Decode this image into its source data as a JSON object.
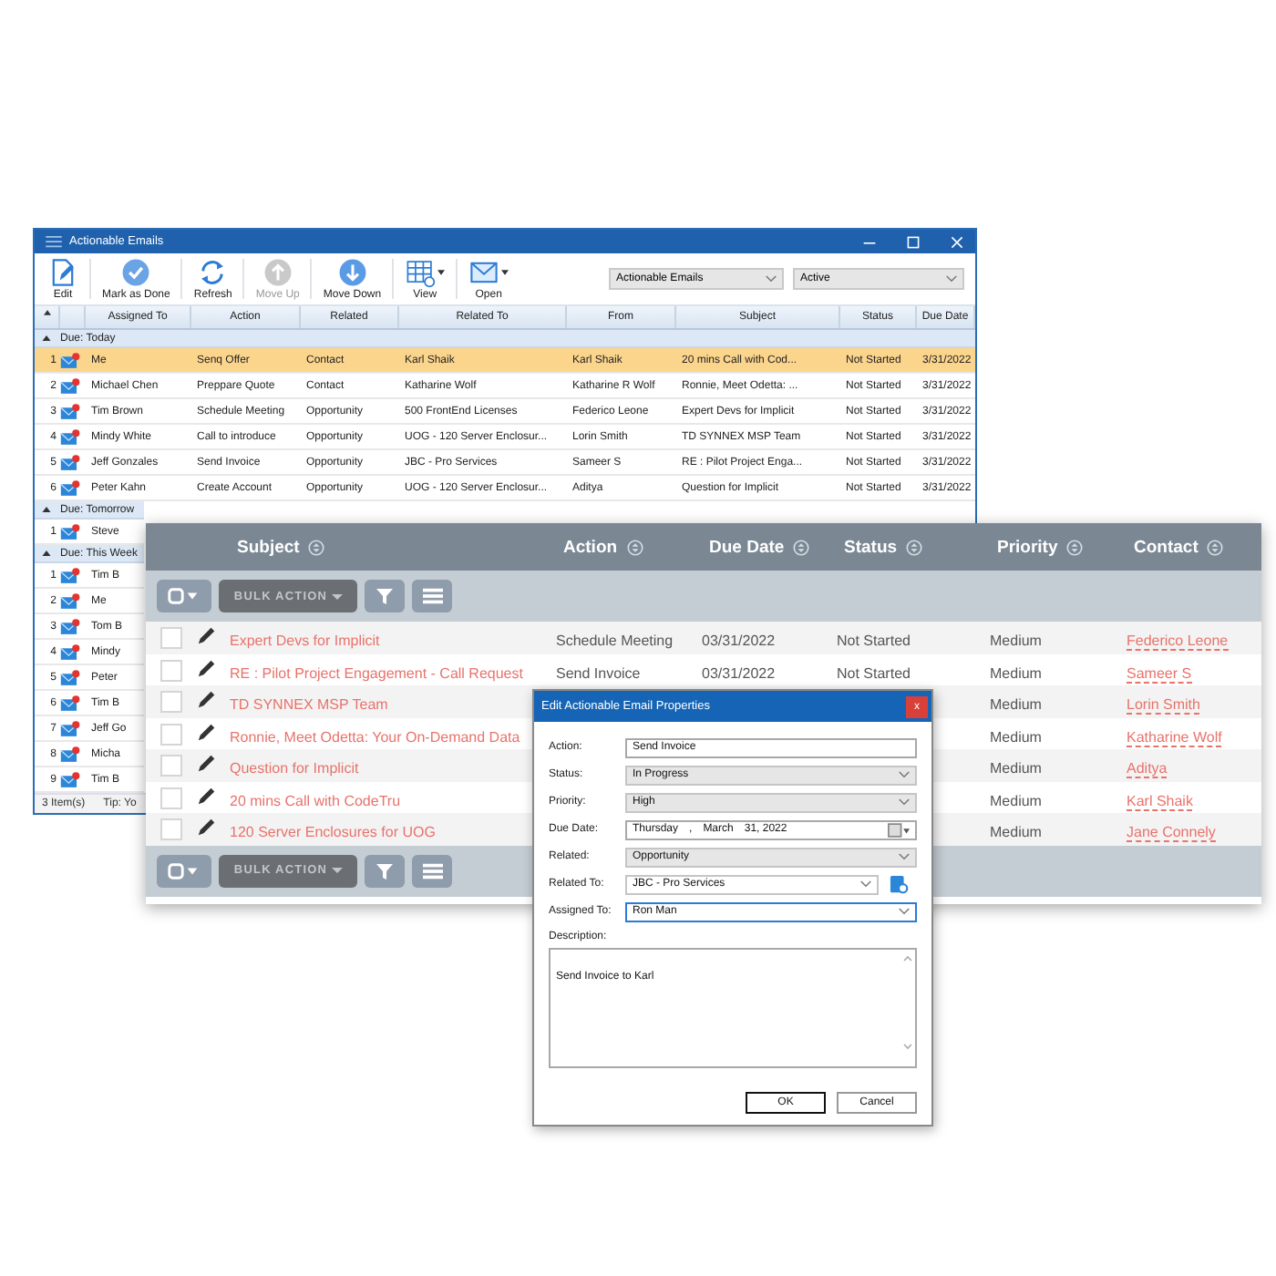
{
  "main_window": {
    "title": "Actionable Emails",
    "toolbar": [
      {
        "label": "Edit",
        "disabled": false,
        "has_menu": false
      },
      {
        "label": "Mark as Done",
        "disabled": false,
        "has_menu": false
      },
      {
        "label": "Refresh",
        "disabled": false,
        "has_menu": false
      },
      {
        "label": "Move Up",
        "disabled": true,
        "has_menu": false
      },
      {
        "label": "Move Down",
        "disabled": false,
        "has_menu": false
      },
      {
        "label": "View",
        "disabled": false,
        "has_menu": true
      },
      {
        "label": "Open",
        "disabled": false,
        "has_menu": true
      }
    ],
    "filters": [
      "Actionable Emails",
      "Active"
    ],
    "columns": [
      "Assigned To",
      "Action",
      "Related",
      "Related To",
      "From",
      "Subject",
      "Status",
      "Due Date"
    ],
    "groups": [
      {
        "title": "Due: Today",
        "expanded": true,
        "rows": [
          {
            "number": "1",
            "cells": [
              "Me",
              "Senq Offer",
              "Contact",
              "Karl Shaik",
              "Karl Shaik",
              "20 mins Call with Cod...",
              "Not Started",
              "3/31/2022"
            ],
            "selected": true
          },
          {
            "number": "2",
            "cells": [
              "Michael Chen",
              "Preppare Quote",
              "Contact",
              "Katharine Wolf",
              "Katharine R Wolf",
              "Ronnie, Meet Odetta: ...",
              "Not Started",
              "3/31/2022"
            ],
            "selected": false
          },
          {
            "number": "3",
            "cells": [
              "Tim Brown",
              "Schedule Meeting",
              "Opportunity",
              "500 FrontEnd Licenses",
              "Federico Leone",
              "Expert Devs for Implicit",
              "Not Started",
              "3/31/2022"
            ],
            "selected": false
          },
          {
            "number": "4",
            "cells": [
              "Mindy White",
              "Call to introduce",
              "Opportunity",
              "UOG - 120 Server Enclosur...",
              "Lorin Smith",
              "TD SYNNEX MSP Team",
              "Not Started",
              "3/31/2022"
            ],
            "selected": false
          },
          {
            "number": "5",
            "cells": [
              "Jeff Gonzales",
              "Send Invoice",
              "Opportunity",
              "JBC - Pro Services",
              "Sameer S",
              "RE : Pilot Project Enga...",
              "Not Started",
              "3/31/2022"
            ],
            "selected": false
          },
          {
            "number": "6",
            "cells": [
              "Peter Kahn",
              "Create Account",
              "Opportunity",
              "UOG - 120 Server Enclosur...",
              "Aditya",
              "Question for Implicit",
              "Not Started",
              "3/31/2022"
            ],
            "selected": false
          }
        ]
      },
      {
        "title": "Due: Tomorrow",
        "expanded": true,
        "rows": [
          {
            "number": "1",
            "cells": [
              "Steve"
            ],
            "selected": false
          }
        ]
      },
      {
        "title": "Due: This Week",
        "expanded": true,
        "rows": [
          {
            "number": "1",
            "cells": [
              "Tim B"
            ],
            "selected": false
          },
          {
            "number": "2",
            "cells": [
              "Me"
            ],
            "selected": false
          },
          {
            "number": "3",
            "cells": [
              "Tom B"
            ],
            "selected": false
          },
          {
            "number": "4",
            "cells": [
              "Mindy"
            ],
            "selected": false
          },
          {
            "number": "5",
            "cells": [
              "Peter"
            ],
            "selected": false
          },
          {
            "number": "6",
            "cells": [
              "Tim B"
            ],
            "selected": false
          },
          {
            "number": "7",
            "cells": [
              "Jeff Go"
            ],
            "selected": false
          },
          {
            "number": "8",
            "cells": [
              "Micha"
            ],
            "selected": false
          },
          {
            "number": "9",
            "cells": [
              "Tim B"
            ],
            "selected": false
          }
        ]
      }
    ],
    "status_bar": {
      "count": "3 Item(s)",
      "tip": "Tip: Yo"
    }
  },
  "grid": {
    "columns": [
      "Subject",
      "Action",
      "Due Date",
      "Status",
      "Priority",
      "Contact"
    ],
    "toolbars": [
      {
        "bulk_action": "BULK ACTION",
        "bulk_disabled": true
      },
      {
        "bulk_action": "BULK ACTION",
        "bulk_disabled": true
      }
    ],
    "rows": [
      {
        "checked": false,
        "subject": "Expert Devs for Implicit",
        "action": "Schedule Meeting",
        "due_date": "03/31/2022",
        "status": "Not Started",
        "priority": "Medium",
        "contact": "Federico Leone"
      },
      {
        "checked": false,
        "subject": "RE : Pilot Project Engagement - Call Request",
        "action": "Send Invoice",
        "due_date": "03/31/2022",
        "status": "Not Started",
        "priority": "Medium",
        "contact": "Sameer S"
      },
      {
        "checked": false,
        "subject": "TD SYNNEX MSP Team",
        "priority": "Medium",
        "contact": "Lorin Smith"
      },
      {
        "checked": false,
        "subject": "Ronnie, Meet Odetta: Your On-Demand Data",
        "priority": "Medium",
        "contact": "Katharine Wolf"
      },
      {
        "checked": false,
        "subject": "Question for Implicit",
        "priority": "Medium",
        "contact": "Aditya"
      },
      {
        "checked": false,
        "subject": "20 mins Call with CodeTru",
        "priority": "Medium",
        "contact": "Karl Shaik"
      },
      {
        "checked": false,
        "subject": "120 Server Enclosures for UOG",
        "priority": "Medium",
        "contact": "Jane Connely"
      }
    ]
  },
  "dialog": {
    "title": "Edit Actionable Email Properties",
    "close": "x",
    "fields": [
      {
        "label": "Action:",
        "kind": "text",
        "value": "Send Invoice",
        "focused": false
      },
      {
        "label": "Status:",
        "kind": "select",
        "value": "In Progress",
        "focused": false
      },
      {
        "label": "Priority:",
        "kind": "select",
        "value": "High",
        "focused": false
      },
      {
        "label": "Due Date:",
        "kind": "date",
        "parts": [
          "Thursday",
          ",",
          "March",
          "31, 2022"
        ],
        "focused": false
      },
      {
        "label": "Related:",
        "kind": "select",
        "value": "Opportunity",
        "focused": false
      },
      {
        "label": "Related To:",
        "kind": "lookup",
        "value": "JBC - Pro Services",
        "focused": false
      },
      {
        "label": "Assigned To:",
        "kind": "select",
        "value": "Ron Man",
        "focused": true
      }
    ],
    "description_label": "Description:",
    "description": "Send Invoice to Karl",
    "buttons": [
      {
        "label": "OK",
        "default": true
      },
      {
        "label": "Cancel",
        "default": false
      }
    ]
  }
}
